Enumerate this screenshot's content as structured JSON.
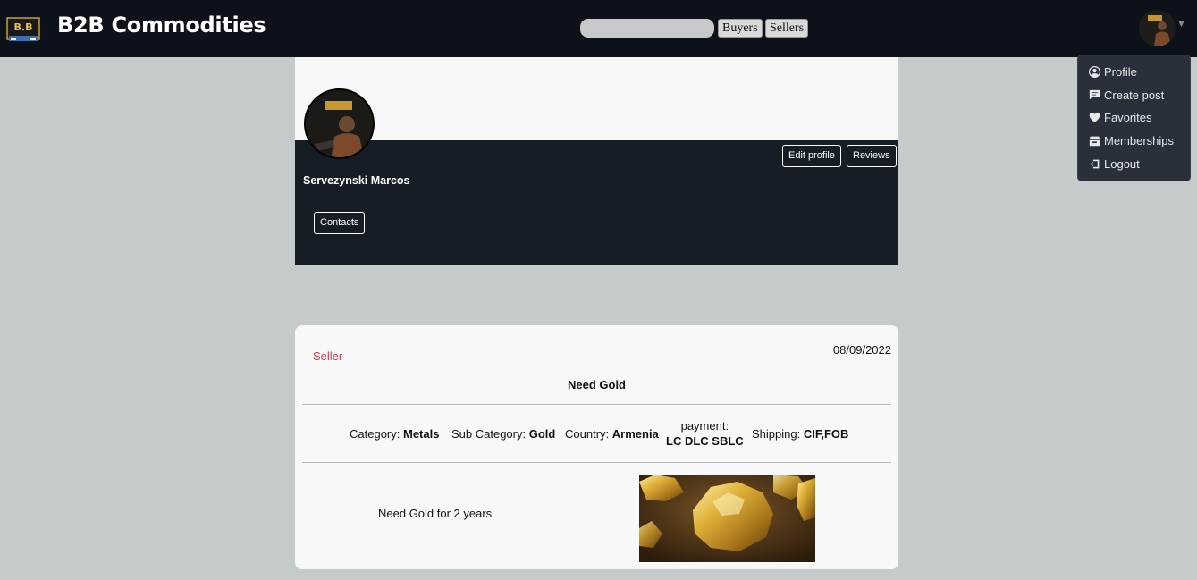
{
  "header": {
    "brand": "B2B Commodities",
    "logo_text": "B.B",
    "search_placeholder": "",
    "buyers_label": "Buyers",
    "sellers_label": "Sellers"
  },
  "user_menu": {
    "items": [
      {
        "label": "Profile",
        "icon": "user-circle-icon"
      },
      {
        "label": "Create post",
        "icon": "message-icon"
      },
      {
        "label": "Favorites",
        "icon": "heart-icon"
      },
      {
        "label": "Memberships",
        "icon": "store-icon"
      },
      {
        "label": "Logout",
        "icon": "logout-icon"
      }
    ]
  },
  "profile": {
    "name": "Servezynski Marcos",
    "edit_label": "Edit profile",
    "reviews_label": "Reviews",
    "contacts_label": "Contacts"
  },
  "post": {
    "role": "Seller",
    "date": "08/09/2022",
    "title": "Need Gold",
    "category_label": "Category:",
    "category": "Metals",
    "subcategory_label": "Sub Category:",
    "subcategory": "Gold",
    "country_label": "Country:",
    "country": "Armenia",
    "payment_label": "payment:",
    "payment": "LC DLC SBLC",
    "shipping_label": "Shipping:",
    "shipping": "CIF,FOB",
    "description": "Need Gold for 2 years"
  },
  "colors": {
    "navbar": "#0c111a",
    "page_bg": "#c5cbcb",
    "profile_banner": "#161d24",
    "role_accent": "#d63a4d",
    "dropdown_bg": "#2a3039"
  }
}
